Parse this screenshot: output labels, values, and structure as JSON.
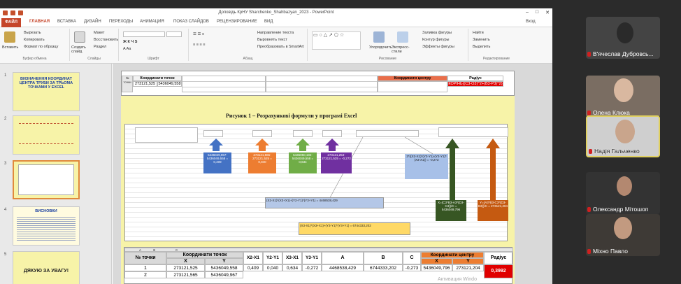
{
  "window": {
    "title": "Доповідь КрНУ Sharchenko_Shahbazyan_2023 - PowerPoint",
    "login": "Вход"
  },
  "tabs": [
    "ФАЙЛ",
    "ГЛАВНАЯ",
    "ВСТАВКА",
    "ДИЗАЙН",
    "ПЕРЕХОДЫ",
    "АНИМАЦИЯ",
    "ПОКАЗ СЛАЙДОВ",
    "РЕЦЕНЗИРОВАНИЕ",
    "ВИД"
  ],
  "ribbon": {
    "clipboard": {
      "paste": "Вставить",
      "cut": "Вырезать",
      "copy": "Копировать",
      "format": "Формат по образцу",
      "label": "Буфер обмена"
    },
    "slides": {
      "create": "Создать слайд",
      "layout": "Макет",
      "reset": "Восстановить",
      "section": "Раздел",
      "label": "Слайды"
    },
    "font": {
      "label": "Шрифт"
    },
    "paragraph": {
      "dir": "Направление текста",
      "align": "Выровнять текст",
      "smartart": "Преобразовать в SmartArt",
      "label": "Абзац"
    },
    "drawing": {
      "arrange": "Упорядочить",
      "styles": "Экспресс-стили",
      "fill": "Заливка фигуры",
      "outline": "Контур фигуры",
      "effects": "Эффекты фигуры",
      "label": "Рисование"
    },
    "editing": {
      "find": "Найти",
      "replace": "Заменить",
      "select": "Выделить",
      "label": "Редактирование"
    }
  },
  "thumbnails": [
    {
      "num": "1",
      "title": "ВИЗНАЧЕННЯ КООРДИНАТ ЦЕНТРА ТРУБИ ЗА ТРЬОМА ТОЧКАМИ У EXCEL"
    },
    {
      "num": "2",
      "title": ""
    },
    {
      "num": "3",
      "title": ""
    },
    {
      "num": "4",
      "title": "ВИСНОВКИ"
    },
    {
      "num": "5",
      "title": "ДЯКУЮ ЗА УВАГУ!"
    }
  ],
  "slide": {
    "caption": "Рисунок 1 – Розрахункові формули у програмі Excel",
    "top_header": {
      "pt": "№ точки",
      "coords": "Координати точок",
      "center": "Координати центру",
      "radius": "Радіус"
    },
    "formula_red": "КОРІНЬ((С3-О3)^2+(В3-Р3)^2)",
    "bottom_table": {
      "pt": "№ точки",
      "coords": "Координати точок",
      "x": "X",
      "y": "Y",
      "cols": [
        "X2-X1",
        "Y2-Y1",
        "X3-X1",
        "Y3-Y1",
        "A",
        "B",
        "C"
      ],
      "center": "Координати центру",
      "radius": "Радіус",
      "rows": [
        {
          "n": "1",
          "x": "273121,525",
          "y": "5436049,558",
          "vals": [
            "0,409",
            "0,040",
            "0,634",
            "-0,272",
            "4468538,429",
            "6744333,202",
            "-0,273"
          ],
          "cx": "5436049,796",
          "cy": "273121,204",
          "r": "0,3992"
        },
        {
          "n": "2",
          "x": "273121,565",
          "y": "5436049,967"
        }
      ]
    },
    "watermark": "Активация Windo"
  },
  "participants": [
    {
      "name": "В'ячеслав Дубровсь..."
    },
    {
      "name": "Олена Клюка"
    },
    {
      "name": "Надія Гальченко"
    },
    {
      "name": "Олександр Мітошоп"
    },
    {
      "name": "Міхно Павло"
    }
  ],
  "colors": {
    "file_tab": "#c5452a",
    "slide_bg": "#f7f3a8",
    "arrow_blue": "#4472c4",
    "arrow_orange": "#ed7d31",
    "arrow_green": "#70ad47",
    "arrow_purple": "#7030a0",
    "radius_red": "#e00000"
  }
}
